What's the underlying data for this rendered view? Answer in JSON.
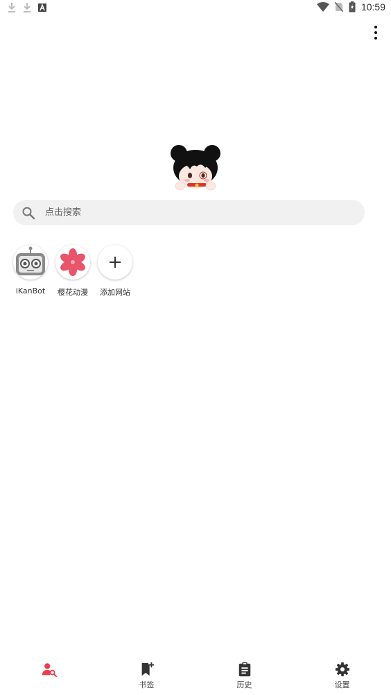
{
  "status_bar": {
    "time": "10:59",
    "left_icons": [
      "download-icon",
      "download-icon",
      "app-a-icon"
    ],
    "right_icons": [
      "wifi-icon",
      "no-sim-icon",
      "battery-charging-icon"
    ]
  },
  "toolbar": {
    "menu_icon": "more-vert-icon"
  },
  "logo": {
    "icon": "mascot-logo"
  },
  "search": {
    "placeholder": "点击搜索",
    "value": ""
  },
  "shortcuts": [
    {
      "label": "iKanBot",
      "icon": "robot-icon"
    },
    {
      "label": "樱花动漫",
      "icon": "sakura-flower-icon"
    },
    {
      "label": "添加网站",
      "icon": "plus-icon"
    }
  ],
  "bottom_nav": {
    "active_color": "#e8404d",
    "items": [
      {
        "label": "",
        "icon": "person-search-icon",
        "active": true
      },
      {
        "label": "书签",
        "icon": "bookmark-add-icon"
      },
      {
        "label": "历史",
        "icon": "clipboard-history-icon"
      },
      {
        "label": "设置",
        "icon": "gear-icon"
      }
    ]
  }
}
